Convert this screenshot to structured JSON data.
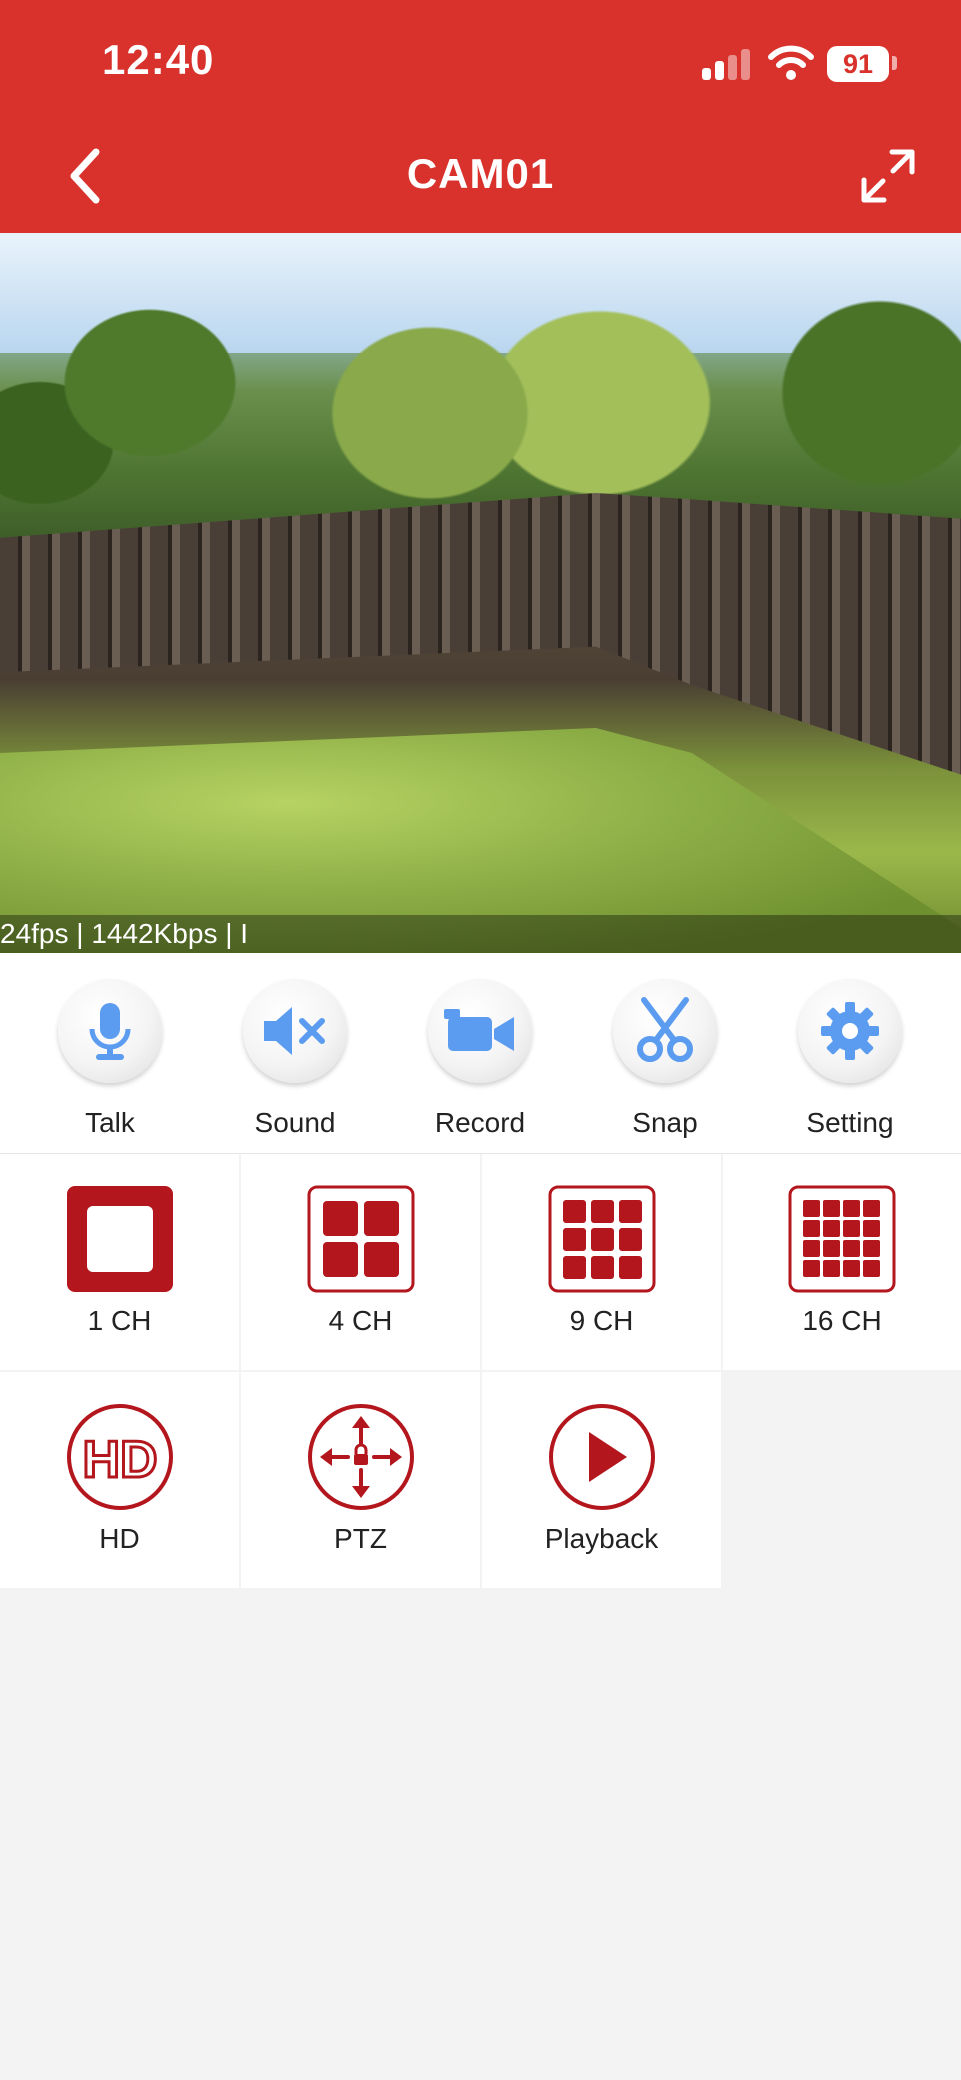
{
  "status_bar": {
    "time": "12:40",
    "battery": "91"
  },
  "header": {
    "title": "CAM01"
  },
  "video": {
    "info": "24fps | 1442Kbps | I"
  },
  "toolbar": [
    {
      "label": "Talk",
      "icon": "microphone-icon"
    },
    {
      "label": "Sound",
      "icon": "speaker-muted-icon"
    },
    {
      "label": "Record",
      "icon": "video-camera-icon"
    },
    {
      "label": "Snap",
      "icon": "scissors-icon"
    },
    {
      "label": "Setting",
      "icon": "gear-icon"
    }
  ],
  "grid": [
    {
      "label": "1 CH",
      "icon": "single-channel-icon"
    },
    {
      "label": "4 CH",
      "icon": "four-channel-grid-icon"
    },
    {
      "label": "9 CH",
      "icon": "nine-channel-grid-icon"
    },
    {
      "label": "16 CH",
      "icon": "sixteen-channel-grid-icon"
    },
    {
      "label": "HD",
      "icon": "hd-icon"
    },
    {
      "label": "PTZ",
      "icon": "ptz-icon"
    },
    {
      "label": "Playback",
      "icon": "play-icon"
    }
  ],
  "colors": {
    "brand": "#d9322c",
    "icon_red": "#b3161c",
    "tool_blue": "#5b9cf0"
  }
}
